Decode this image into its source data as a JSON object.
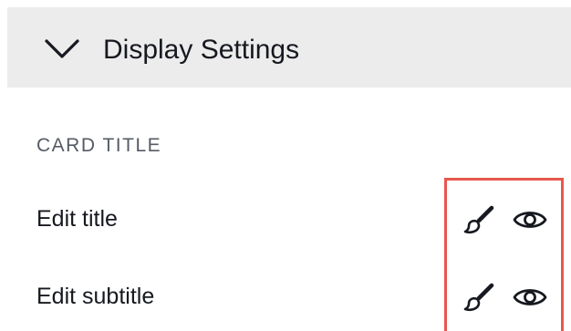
{
  "section": {
    "title": "Display Settings",
    "expanded": true,
    "toggle_icon": "chevron-down-icon"
  },
  "card_title_group": {
    "label": "CARD TITLE",
    "rows": [
      {
        "label": "Edit title",
        "actions": [
          {
            "icon": "paintbrush-icon",
            "action": "format"
          },
          {
            "icon": "eye-icon",
            "action": "visibility"
          }
        ]
      },
      {
        "label": "Edit subtitle",
        "actions": [
          {
            "icon": "paintbrush-icon",
            "action": "format"
          },
          {
            "icon": "eye-icon",
            "action": "visibility"
          }
        ]
      }
    ]
  },
  "colors": {
    "header_bg": "#ececec",
    "text_primary": "#16191f",
    "text_secondary": "#545b64",
    "highlight": "#e8574f"
  }
}
